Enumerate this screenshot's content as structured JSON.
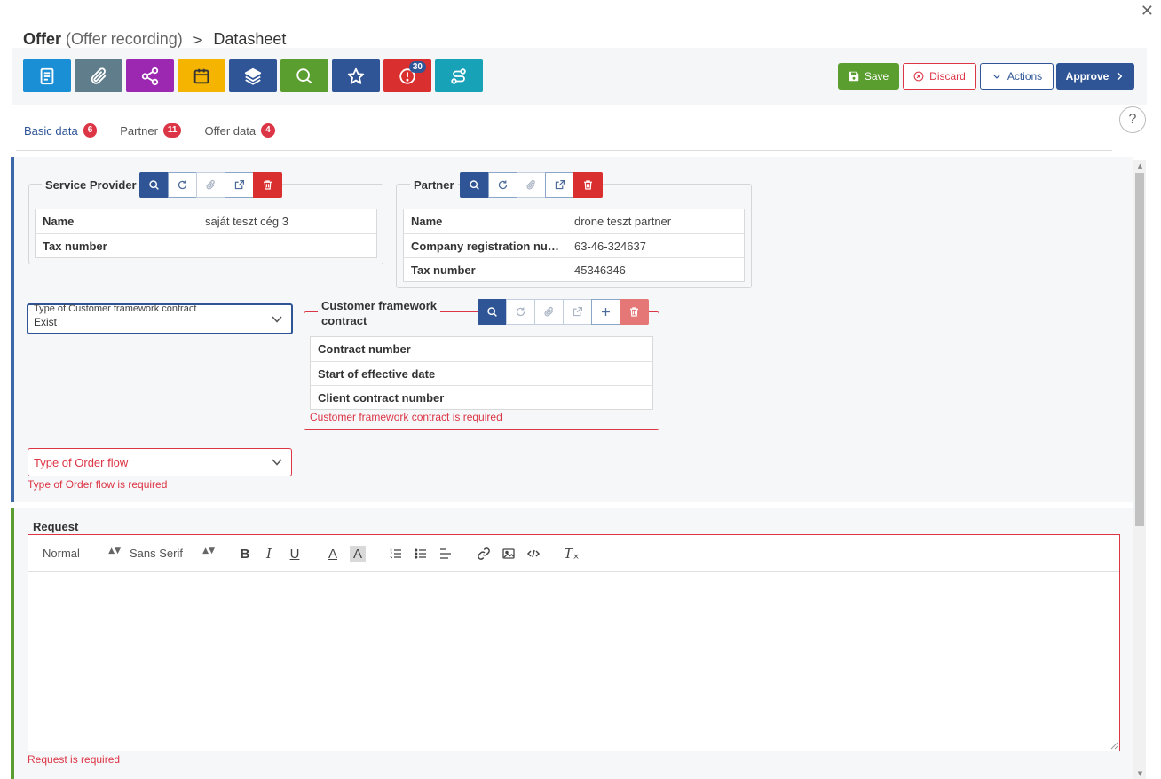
{
  "window": {
    "close_icon": "close-icon"
  },
  "header": {
    "title_main": "Offer",
    "title_sub": "(Offer recording)",
    "title_page": "Datasheet",
    "separator": ">"
  },
  "toolbar": {
    "icon_buttons": [
      {
        "name": "document",
        "icon": "document-icon",
        "color": "#1a8fd6"
      },
      {
        "name": "attachment",
        "icon": "paperclip-icon",
        "color": "#607d8b"
      },
      {
        "name": "share",
        "icon": "share-icon",
        "color": "#9c27b0"
      },
      {
        "name": "calendar",
        "icon": "calendar-icon",
        "color": "#f4b400"
      },
      {
        "name": "layers",
        "icon": "layers-icon",
        "color": "#2f5597"
      },
      {
        "name": "comments",
        "icon": "chat-icon",
        "color": "#5a9e2f"
      },
      {
        "name": "favorite",
        "icon": "star-icon",
        "color": "#2f5597"
      },
      {
        "name": "alerts",
        "icon": "alert-icon",
        "color": "#d9302f",
        "badge": "30"
      },
      {
        "name": "route",
        "icon": "route-icon",
        "color": "#17a2b8"
      }
    ],
    "save_label": "Save",
    "discard_label": "Discard",
    "actions_label": "Actions",
    "approve_label": "Approve"
  },
  "help": {
    "label": "?"
  },
  "tabs": [
    {
      "label": "Basic data",
      "count": "6",
      "active": true
    },
    {
      "label": "Partner",
      "count": "11",
      "active": false
    },
    {
      "label": "Offer data",
      "count": "4",
      "active": false
    }
  ],
  "service_provider": {
    "legend": "Service Provider",
    "rows": [
      {
        "key": "Name",
        "value": "saját teszt cég 3"
      },
      {
        "key": "Tax number",
        "value": ""
      }
    ]
  },
  "partner": {
    "legend": "Partner",
    "rows": [
      {
        "key": "Name",
        "value": "drone teszt partner"
      },
      {
        "key": "Company registration num...",
        "value": "63-46-324637"
      },
      {
        "key": "Tax number",
        "value": "45346346"
      }
    ]
  },
  "framework_type": {
    "label": "Type of Customer framework contract",
    "value": "Exist"
  },
  "framework_contract": {
    "legend_line1": "Customer framework",
    "legend_line2": "contract",
    "rows": [
      {
        "key": "Contract number",
        "value": ""
      },
      {
        "key": "Start of effective date",
        "value": ""
      },
      {
        "key": "Client contract number",
        "value": ""
      }
    ],
    "error": "Customer framework contract is required"
  },
  "order_flow": {
    "placeholder": "Type of Order flow",
    "error": "Type of Order flow is required"
  },
  "request": {
    "label": "Request",
    "format_select": "Normal",
    "font_select": "Sans Serif",
    "bold": "B",
    "italic": "I",
    "underline": "U",
    "text_color": "A",
    "clear_format": "T",
    "error": "Request is required"
  },
  "colors": {
    "primary": "#2f5597",
    "success": "#5a9e2f",
    "danger": "#dc3545"
  }
}
